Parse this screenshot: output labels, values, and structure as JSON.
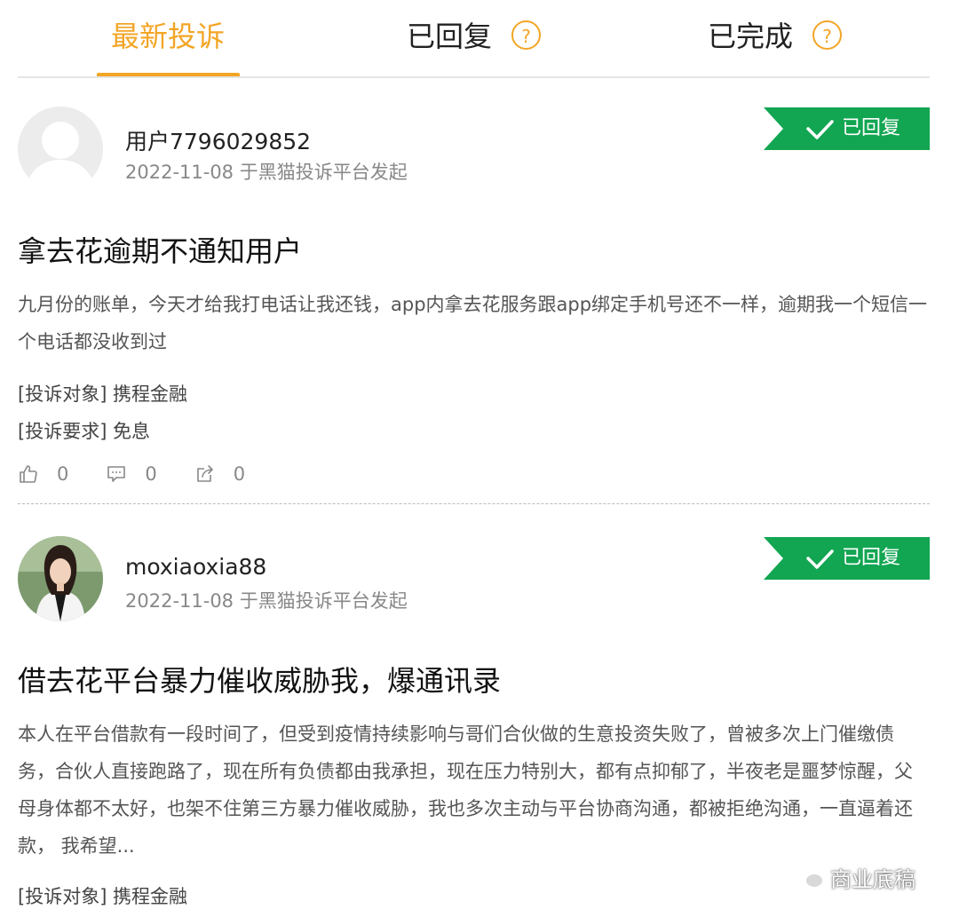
{
  "tabs": [
    {
      "label": "最新投诉",
      "active": true
    },
    {
      "label": "已回复",
      "help_icon": "question-circle-icon"
    },
    {
      "label": "已完成",
      "help_icon": "question-circle-icon"
    }
  ],
  "help_glyph": "?",
  "complaints": [
    {
      "user": "用户7796029852",
      "meta": "2022-11-08 于黑猫投诉平台发起",
      "status": "已回复",
      "title": "拿去花逾期不通知用户",
      "body": "九月份的账单，今天才给我打电话让我还钱，app内拿去花服务跟app绑定手机号还不一样，逾期我一个短信一个电话都没收到过",
      "target": "[投诉对象] 携程金融",
      "demand": "[投诉要求] 免息",
      "likes": "0",
      "comments": "0",
      "shares": "0"
    },
    {
      "user": "moxiaoxia88",
      "meta": "2022-11-08 于黑猫投诉平台发起",
      "status": "已回复",
      "title": "借去花平台暴力催收威胁我，爆通讯录",
      "body": "本人在平台借款有一段时间了，但受到疫情持续影响与哥们合伙做的生意投资失败了，曾被多次上门催缴债务，合伙人直接跑路了，现在所有负债都由我承担，现在压力特别大，都有点抑郁了，半夜老是噩梦惊醒，父母身体都不太好，也架不住第三方暴力催收威胁，我也多次主动与平台协商沟通，都被拒绝沟通，一直逼着还款， 我希望...",
      "target": "[投诉对象] 携程金融"
    }
  ],
  "watermark": "商业底稿",
  "colors": {
    "accent": "#f3a526",
    "badge_green": "#12a552"
  }
}
